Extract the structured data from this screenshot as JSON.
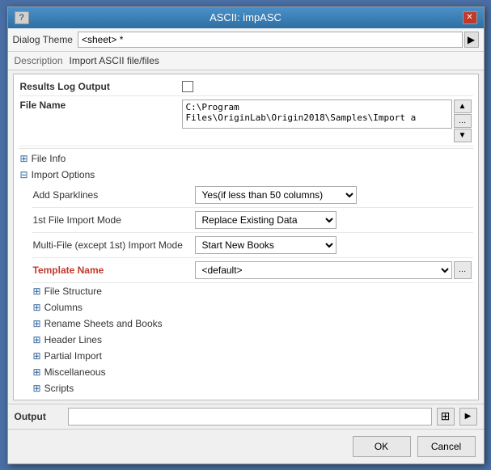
{
  "window": {
    "title": "ASCII: impASC",
    "help_label": "?",
    "close_label": "✕"
  },
  "toolbar": {
    "label": "Dialog Theme",
    "value": "<sheet> *",
    "arrow": "▶"
  },
  "description": {
    "label": "Description",
    "value": "Import ASCII file/files"
  },
  "form": {
    "results_log": {
      "label": "Results Log Output"
    },
    "file_name": {
      "label": "File Name",
      "value": "C:\\Program Files\\OriginLab\\Origin2018\\Samples\\Import a"
    },
    "file_info": {
      "label": "File Info"
    },
    "import_options": {
      "label": "Import Options"
    },
    "add_sparklines": {
      "label": "Add Sparklines",
      "value": "Yes(if less than 50 columns)"
    },
    "first_file_import": {
      "label": "1st File Import Mode",
      "value": "Replace Existing Data"
    },
    "multi_file_import": {
      "label": "Multi-File (except 1st) Import Mode",
      "value": "Start New Books"
    },
    "template_name": {
      "label": "Template Name",
      "value": "<default>"
    },
    "file_structure": {
      "label": "File Structure"
    },
    "columns": {
      "label": "Columns"
    },
    "rename_sheets": {
      "label": "Rename Sheets and Books"
    },
    "header_lines": {
      "label": "Header Lines"
    },
    "partial_import": {
      "label": "Partial Import"
    },
    "miscellaneous": {
      "label": "Miscellaneous"
    },
    "scripts": {
      "label": "Scripts"
    }
  },
  "output": {
    "label": "Output",
    "value": ""
  },
  "footer": {
    "ok_label": "OK",
    "cancel_label": "Cancel"
  },
  "icons": {
    "expand": "⊞",
    "collapse": "⊟",
    "arrow_right": "▶",
    "arrow_down": "▼",
    "dots": "..."
  }
}
